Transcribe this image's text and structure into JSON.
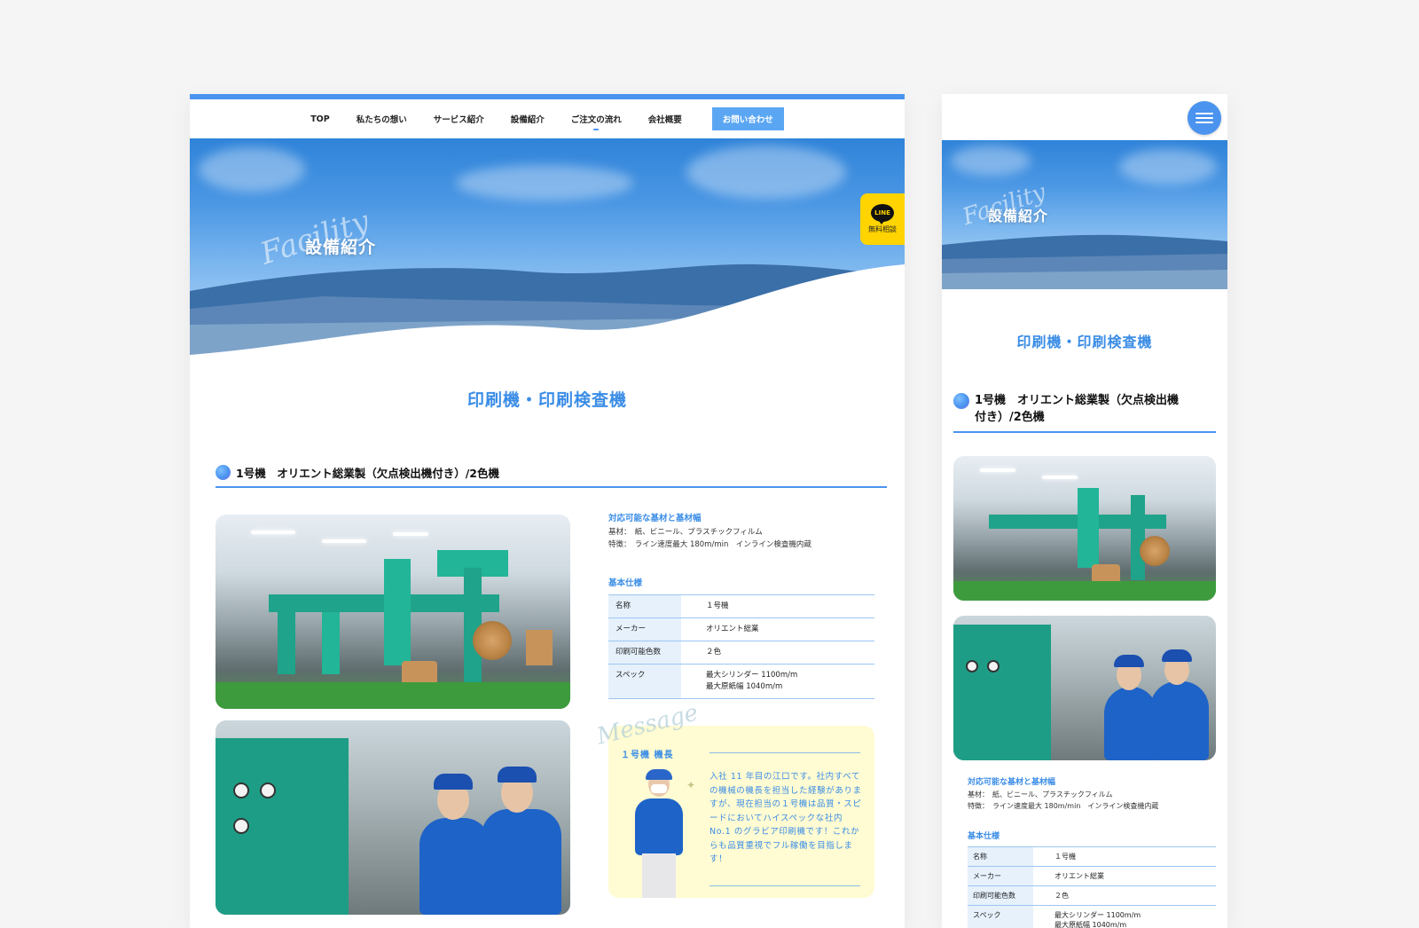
{
  "nav": {
    "items": [
      "TOP",
      "私たちの想い",
      "サービス紹介",
      "設備紹介",
      "ご注文の流れ",
      "会社概要"
    ],
    "contact": "お問い合わせ"
  },
  "hero": {
    "script": "Facility",
    "title": "設備紹介"
  },
  "line_tab": {
    "badge": "LINE",
    "label": "無料相談"
  },
  "section_title": "印刷機・印刷検査機",
  "machine": {
    "heading": "1号機　オリエント総業製（欠点検出機付き）/2色機",
    "heading_mobile_l1": "1号機　オリエント総業製（欠点検出機",
    "heading_mobile_l2": "付き）/2色機",
    "substrate_label": "対応可能な基材と基材幅",
    "substrate_line": "基材：　紙、ビニール、プラスチックフィルム",
    "feature_line": "特徴：　ライン速度最大 180m/min　インライン検査機内蔵",
    "spec_label": "基本仕様",
    "spec": [
      {
        "k": "名称",
        "v": "１号機"
      },
      {
        "k": "メーカー",
        "v": "オリエント総業"
      },
      {
        "k": "印刷可能色数",
        "v": "２色"
      },
      {
        "k": "スペック",
        "v": "最大シリンダー 1100m/m",
        "v2": "最大原紙幅 1040m/m"
      }
    ]
  },
  "message": {
    "script": "Message",
    "name": "１号機 機長",
    "text": "入社 11 年目の江口です。社内すべての機械の機長を担当した経験がありますが、現在担当の１号機は品質・スピードにおいてハイスペックな社内 No.1 のグラビア印刷機です！これからも品質重視でフル稼働を目指します！"
  },
  "icons": [
    "menu-icon",
    "line-chat-icon",
    "bullet-dot-icon"
  ],
  "colors": {
    "accent": "#4a94ef",
    "heading_blue": "#3b8de6",
    "line_yellow": "#ffd400",
    "message_bg": "#fffbd2"
  }
}
